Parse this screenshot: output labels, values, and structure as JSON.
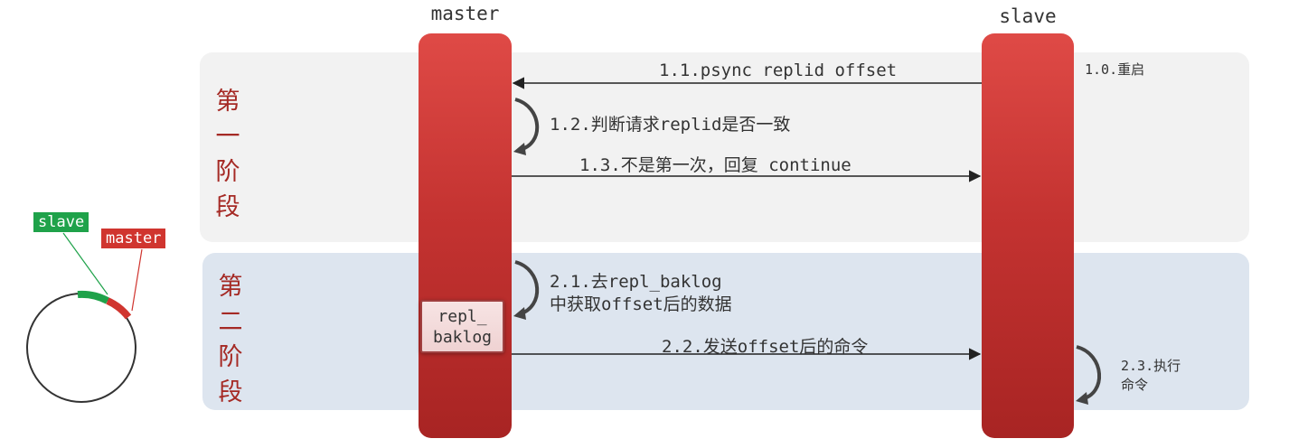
{
  "phases": [
    {
      "title_chars": [
        "第",
        "一",
        "阶",
        "段"
      ]
    },
    {
      "title_chars": [
        "第",
        "二",
        "阶",
        "段"
      ]
    }
  ],
  "lanes": {
    "master_label": "master",
    "slave_label": "slave"
  },
  "steps": {
    "s1_0": "1.0.重启",
    "s1_1": "1.1.psync replid offset",
    "s1_2": "1.2.判断请求replid是否一致",
    "s1_3": "1.3.不是第一次，回复 continue",
    "s2_1_line1": "2.1.去repl_baklog",
    "s2_1_line2": "中获取offset后的数据",
    "s2_2": "2.2.发送offset后的命令",
    "s2_3_line1": "2.3.执行",
    "s2_3_line2": "命令"
  },
  "baklog": {
    "line1": "repl_",
    "line2": "baklog"
  },
  "ring": {
    "slave_tag": "slave",
    "master_tag": "master"
  },
  "colors": {
    "phase_title": "#a52a25",
    "bar": "#c43331",
    "slave_tag": "#1fa24a",
    "master_tag": "#d0352f"
  }
}
